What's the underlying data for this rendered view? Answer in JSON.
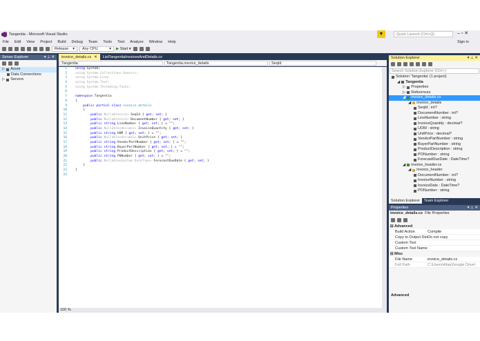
{
  "window": {
    "title": "Tangentia - Microsoft Visual Studio",
    "quick_launch_placeholder": "Quick Launch (Ctrl+Q)",
    "sign_in": "Sign in"
  },
  "menu": [
    "File",
    "Edit",
    "View",
    "Project",
    "Build",
    "Debug",
    "Team",
    "Tools",
    "Test",
    "Analyze",
    "Window",
    "Help"
  ],
  "toolbar": {
    "configuration": "Release",
    "platform": "Any CPU",
    "start": "Start"
  },
  "server_explorer": {
    "title": "Server Explorer",
    "items": [
      "Azure",
      "Data Connections",
      "Servers"
    ]
  },
  "editor": {
    "tabs": [
      "invoice_details.cs",
      "ListTangentiaInvoicesAndDetails.cs"
    ],
    "nav": {
      "project": "Tangentia",
      "class": "Tangentia.invoice_details",
      "member": "SeqId"
    },
    "zoom": "100 %",
    "lines": [
      [
        [
          "using",
          "kw"
        ],
        [
          " System;",
          "tx"
        ]
      ],
      [
        [
          "using System.Collections.Generic;",
          "gr"
        ]
      ],
      [
        [
          "using System.Linq;",
          "gr"
        ]
      ],
      [
        [
          "using System.Text;",
          "gr"
        ]
      ],
      [
        [
          "using System.Threading.Tasks;",
          "gr"
        ]
      ],
      [],
      [
        [
          "namespace",
          "kw"
        ],
        [
          " Tangentia",
          "tx"
        ]
      ],
      [
        [
          "{",
          "tx"
        ]
      ],
      [
        [
          "    public partial class ",
          "kw"
        ],
        [
          "invoice_details",
          "ty"
        ]
      ],
      [
        [
          "    {",
          "tx"
        ]
      ],
      [
        [
          "        public ",
          "kw"
        ],
        [
          "Nullable<int>",
          "gr"
        ],
        [
          " SeqId { ",
          "tx"
        ],
        [
          "get",
          "kw"
        ],
        [
          "; ",
          "tx"
        ],
        [
          "set",
          "kw"
        ],
        [
          "; }",
          "tx"
        ]
      ],
      [
        [
          "        public ",
          "kw"
        ],
        [
          "Nullable<int>",
          "gr"
        ],
        [
          " DocumentNumber { ",
          "tx"
        ],
        [
          "get",
          "kw"
        ],
        [
          "; ",
          "tx"
        ],
        [
          "set",
          "kw"
        ],
        [
          "; }",
          "tx"
        ]
      ],
      [
        [
          "        public string",
          "kw"
        ],
        [
          " LineNumber { ",
          "tx"
        ],
        [
          "get",
          "kw"
        ],
        [
          "; ",
          "tx"
        ],
        [
          "set",
          "kw"
        ],
        [
          "; } = ",
          "tx"
        ],
        [
          "\"\"",
          "st"
        ],
        [
          ";",
          "tx"
        ]
      ],
      [
        [
          "        public ",
          "kw"
        ],
        [
          "Nullable<decimal>",
          "gr"
        ],
        [
          " InvoiceQuantity { ",
          "tx"
        ],
        [
          "get",
          "kw"
        ],
        [
          "; ",
          "tx"
        ],
        [
          "set",
          "kw"
        ],
        [
          "; }",
          "tx"
        ]
      ],
      [
        [
          "        public string",
          "kw"
        ],
        [
          " UOM { ",
          "tx"
        ],
        [
          "get",
          "kw"
        ],
        [
          "; ",
          "tx"
        ],
        [
          "set",
          "kw"
        ],
        [
          "; } = ",
          "tx"
        ],
        [
          "\"\"",
          "st"
        ],
        [
          ";",
          "tx"
        ]
      ],
      [
        [
          "        public ",
          "kw"
        ],
        [
          "Nullable<decimal>",
          "gr"
        ],
        [
          " UnitPrice { ",
          "tx"
        ],
        [
          "get",
          "kw"
        ],
        [
          "; ",
          "tx"
        ],
        [
          "set",
          "kw"
        ],
        [
          "; }",
          "tx"
        ]
      ],
      [
        [
          "        public string",
          "kw"
        ],
        [
          " VendorPartNumber { ",
          "tx"
        ],
        [
          "get",
          "kw"
        ],
        [
          "; ",
          "tx"
        ],
        [
          "set",
          "kw"
        ],
        [
          "; } = ",
          "tx"
        ],
        [
          "\"\"",
          "st"
        ],
        [
          ";",
          "tx"
        ]
      ],
      [
        [
          "        public string",
          "kw"
        ],
        [
          " BuyerPartNumber { ",
          "tx"
        ],
        [
          "get",
          "kw"
        ],
        [
          "; ",
          "tx"
        ],
        [
          "set",
          "kw"
        ],
        [
          "; } = ",
          "tx"
        ],
        [
          "\"\"",
          "st"
        ],
        [
          ";",
          "tx"
        ]
      ],
      [
        [
          "        public string",
          "kw"
        ],
        [
          " ProductDescription { ",
          "tx"
        ],
        [
          "get",
          "kw"
        ],
        [
          "; ",
          "tx"
        ],
        [
          "set",
          "kw"
        ],
        [
          "; } = ",
          "tx"
        ],
        [
          "\"\"",
          "st"
        ],
        [
          ";",
          "tx"
        ]
      ],
      [
        [
          "        public string",
          "kw"
        ],
        [
          " PONumber { ",
          "tx"
        ],
        [
          "get",
          "kw"
        ],
        [
          "; ",
          "tx"
        ],
        [
          "set",
          "kw"
        ],
        [
          "; } = ",
          "tx"
        ],
        [
          "\"\"",
          "st"
        ],
        [
          ";",
          "tx"
        ]
      ],
      [
        [
          "        public ",
          "kw"
        ],
        [
          "Nullable<System.DateTime>",
          "gr"
        ],
        [
          " ForecastDueDate { ",
          "tx"
        ],
        [
          "get",
          "kw"
        ],
        [
          "; ",
          "tx"
        ],
        [
          "set",
          "kw"
        ],
        [
          "; }",
          "tx"
        ]
      ],
      [
        [
          "    }",
          "tx"
        ]
      ],
      [
        [
          "}",
          "tx"
        ]
      ],
      []
    ]
  },
  "solution_explorer": {
    "title": "Solution Explorer",
    "search_placeholder": "Search Solution Explorer (Ctrl+;)",
    "tree": [
      {
        "label": "Solution 'Tangentia' (1 project)",
        "depth": 0
      },
      {
        "label": "Tangentia",
        "depth": 1,
        "bold": true
      },
      {
        "label": "Properties",
        "depth": 2
      },
      {
        "label": "References",
        "depth": 2
      },
      {
        "label": "invoice_details.cs",
        "depth": 2,
        "selected": true
      },
      {
        "label": "invoice_details",
        "depth": 3
      },
      {
        "label": "SeqId : int?",
        "depth": 4
      },
      {
        "label": "DocumentNumber : int?",
        "depth": 4
      },
      {
        "label": "LineNumber : string",
        "depth": 4
      },
      {
        "label": "InvoiceQuantity : decimal?",
        "depth": 4
      },
      {
        "label": "UOM : string",
        "depth": 4
      },
      {
        "label": "UnitPrice : decimal?",
        "depth": 4
      },
      {
        "label": "VendorPartNumber : string",
        "depth": 4
      },
      {
        "label": "BuyerPartNumber : string",
        "depth": 4
      },
      {
        "label": "ProductDescription : string",
        "depth": 4
      },
      {
        "label": "PONumber : string",
        "depth": 4
      },
      {
        "label": "ForecastDueDate : DateTime?",
        "depth": 4
      },
      {
        "label": "invoice_header.cs",
        "depth": 2
      },
      {
        "label": "invoice_header",
        "depth": 3
      },
      {
        "label": "DocumentNumber : int?",
        "depth": 4
      },
      {
        "label": "InvoiceNumber : string",
        "depth": 4
      },
      {
        "label": "InvoiceDate : DateTime?",
        "depth": 4
      },
      {
        "label": "PONumber : string",
        "depth": 4
      }
    ],
    "tabs": [
      "Solution Explorer",
      "Team Explorer"
    ]
  },
  "properties": {
    "title": "Properties",
    "object": "invoice_details.cs",
    "object_type": "File Properties",
    "categories": [
      {
        "name": "Advanced",
        "rows": [
          [
            "Build Action",
            "Compile"
          ],
          [
            "Copy to Output Directory",
            "Do not copy"
          ],
          [
            "Custom Tool",
            ""
          ],
          [
            "Custom Tool Namespace",
            ""
          ]
        ]
      },
      {
        "name": "Misc",
        "rows": [
          [
            "File Name",
            "invoice_details.cs"
          ],
          [
            "Full Path",
            "C:\\Users\\Afaq\\Google Drive\\"
          ]
        ]
      }
    ],
    "description_title": "Advanced"
  },
  "colors": {
    "accent": "#fff29d",
    "frame": "#293955",
    "selection": "#3399ff"
  }
}
